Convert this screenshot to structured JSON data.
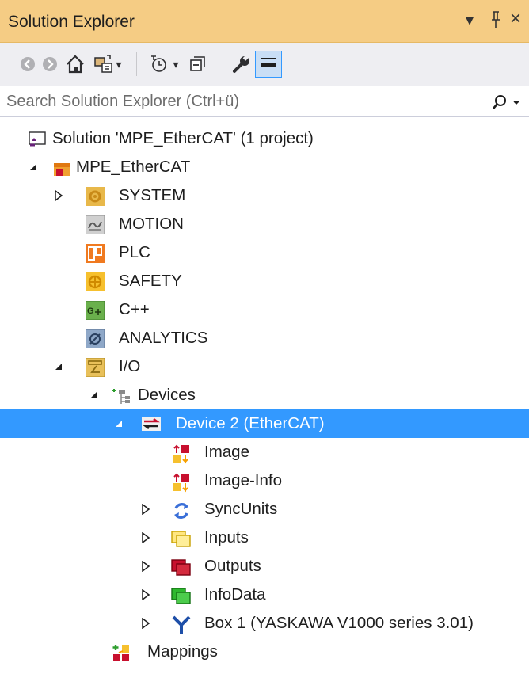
{
  "window": {
    "title": "Solution Explorer",
    "pin_glyph": "❘",
    "dropdown_glyph": "▾",
    "close_glyph": "×"
  },
  "search": {
    "placeholder": "Search Solution Explorer (Ctrl+ü)"
  },
  "toolbar": {
    "icons": [
      "back-icon",
      "forward-icon",
      "home-icon",
      "switch-views-icon",
      "dropdown-icon",
      "pending-changes-icon",
      "dropdown-icon",
      "collapse-all-icon",
      "properties-icon",
      "preview-icon"
    ]
  },
  "tree": {
    "solution": "Solution 'MPE_EtherCAT' (1 project)",
    "project": "MPE_EtherCAT",
    "system": "SYSTEM",
    "motion": "MOTION",
    "plc": "PLC",
    "safety": "SAFETY",
    "cpp": "C++",
    "analytics": "ANALYTICS",
    "io": "I/O",
    "devices": "Devices",
    "device2": "Device 2 (EtherCAT)",
    "image": "Image",
    "image_info": "Image-Info",
    "syncunits": "SyncUnits",
    "inputs": "Inputs",
    "outputs": "Outputs",
    "infodata": "InfoData",
    "box1": "Box 1 (YASKAWA V1000 series 3.01)",
    "mappings": "Mappings"
  },
  "colors": {
    "title_bar": "#f5cc84",
    "selection": "#3399ff",
    "toolbar_bg": "#eeeef2"
  }
}
